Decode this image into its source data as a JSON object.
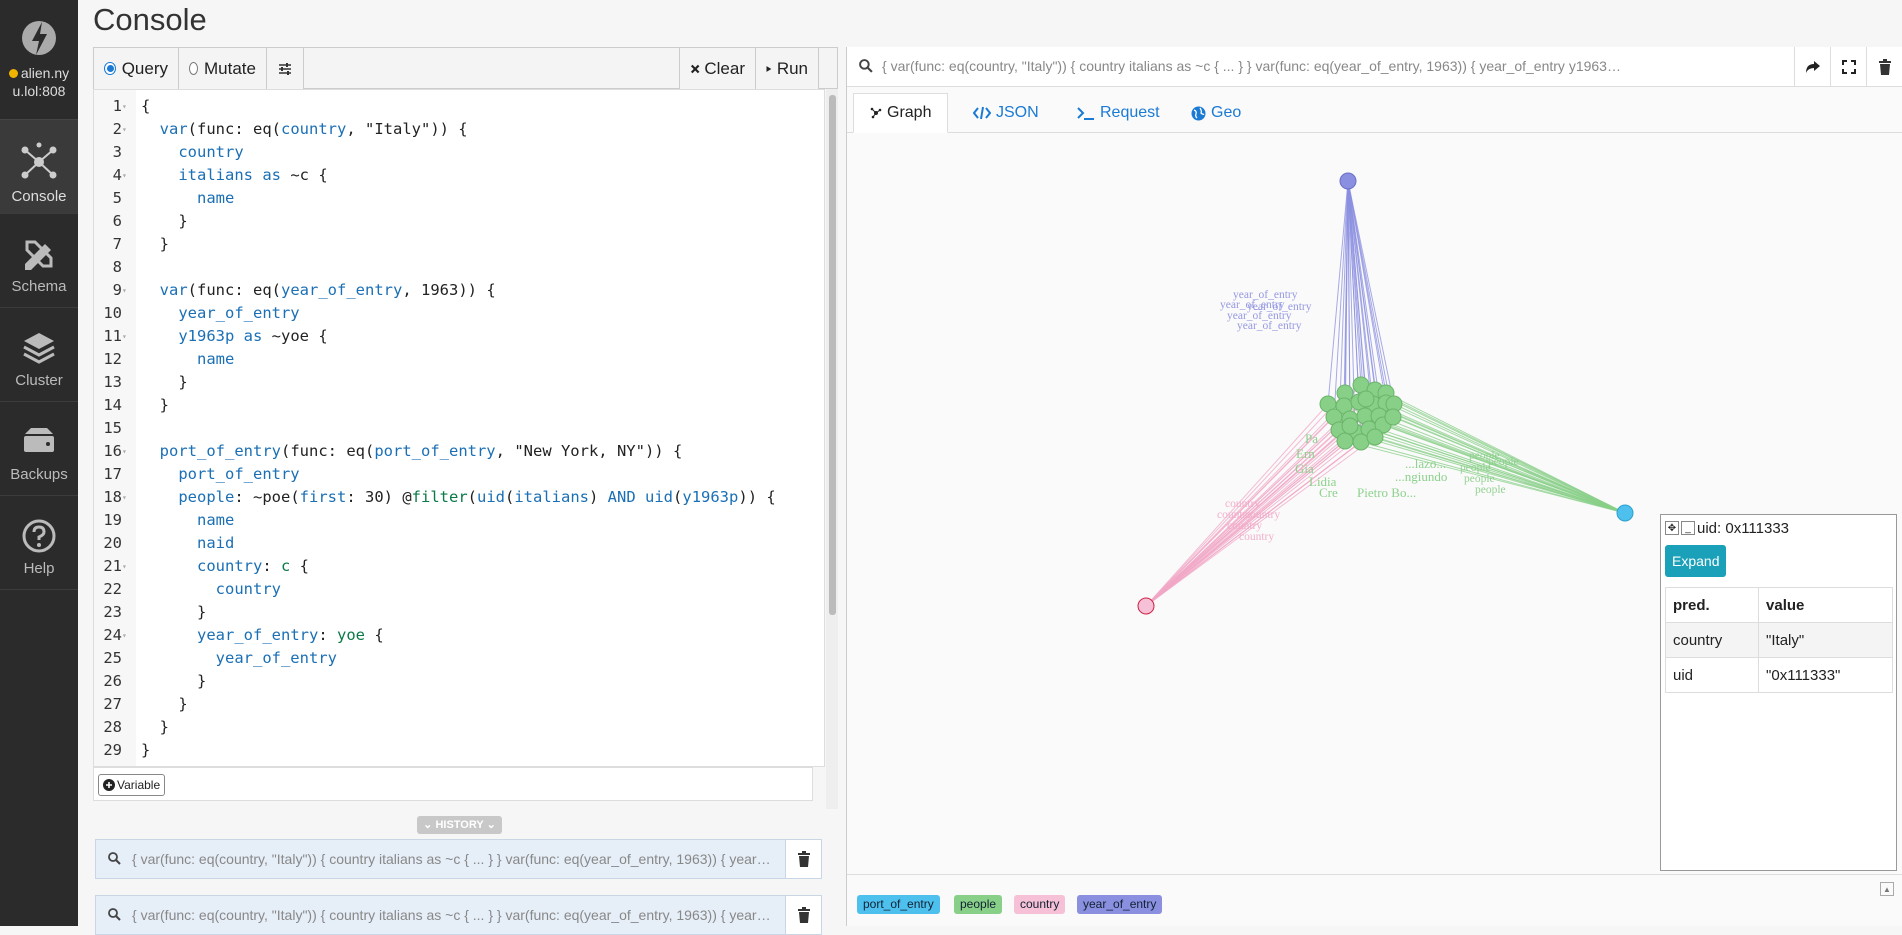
{
  "sidebar": {
    "server_name_line1": "alien.ny",
    "server_name_line2": "u.lol:808",
    "items": [
      {
        "label": "Console",
        "icon": "graph-nodes-icon",
        "active": true
      },
      {
        "label": "Schema",
        "icon": "pencil-ruler-icon"
      },
      {
        "label": "Cluster",
        "icon": "layers-icon"
      },
      {
        "label": "Backups",
        "icon": "storage-icon"
      },
      {
        "label": "Help",
        "icon": "question-icon"
      }
    ]
  },
  "page_title": "Console",
  "toolbar": {
    "query_label": "Query",
    "mutate_label": "Mutate",
    "clear_label": "Clear",
    "run_label": "Run"
  },
  "editor": {
    "line_numbers": [
      "1",
      "2",
      "3",
      "4",
      "5",
      "6",
      "7",
      "8",
      "9",
      "10",
      "11",
      "12",
      "13",
      "14",
      "15",
      "16",
      "17",
      "18",
      "19",
      "20",
      "21",
      "22",
      "23",
      "24",
      "25",
      "26",
      "27",
      "28",
      "29"
    ],
    "lines": [
      "{",
      "  var(func: eq(country, \"Italy\")) {",
      "    country",
      "    italians as ~c {",
      "      name",
      "    }",
      "  }",
      "",
      "  var(func: eq(year_of_entry, 1963)) {",
      "    year_of_entry",
      "    y1963p as ~yoe {",
      "      name",
      "    }",
      "  }",
      "",
      "  port_of_entry(func: eq(port_of_entry, \"New York, NY\")) {",
      "    port_of_entry",
      "    people: ~poe(first: 30) @filter(uid(italians) AND uid(y1963p)) {",
      "      name",
      "      naid",
      "      country: c {",
      "        country",
      "      }",
      "      year_of_entry: yoe {",
      "        year_of_entry",
      "      }",
      "    }",
      "  }",
      "}"
    ],
    "variable_label": "Variable"
  },
  "history": {
    "label": "HISTORY",
    "items": [
      "{ var(func: eq(country, \"Italy\")) { country italians as ~c { ... } } var(func: eq(year_of_entry, 1963)) { year_of_entry y1963p as ~yoe { ... } } port_of_entry(func: eq(port_of_entry, \"New York, NY\")) { ... } }",
      "{ var(func: eq(country, \"Italy\")) { country italians as ~c { ... } } var(func: eq(year_of_entry, 1963)) { year_of_entry y1963p as ~yoe { ... } } port_of_entry(func: eq(port_of_entry, \"New York, NY\")) { ... } }"
    ]
  },
  "result": {
    "query_text": "{ var(func: eq(country, \"Italy\")) { country italians as ~c { ... } } var(func: eq(year_of_entry, 1963)) { year_of_entry y1963p as ~yoe { ... } } port_of_entry(func: eq(port_of_entry, \"New York, NY\")) { ... } }",
    "tabs": [
      "Graph",
      "JSON",
      "Request",
      "Geo"
    ],
    "active_tab": "Graph",
    "graph_labels": {
      "year_label": "year_of_entry",
      "country_label": "country",
      "people_label": "people",
      "name_labels": [
        "Pa",
        "Ern",
        "Gia",
        "Lidia",
        "Cre",
        "Pietro Bo...",
        "...ngiundo",
        "...lazo..."
      ]
    },
    "legend": [
      {
        "label": "port_of_entry",
        "color": "#4dc0ee"
      },
      {
        "label": "people",
        "color": "#88cf88"
      },
      {
        "label": "country",
        "color": "#f6c0d6"
      },
      {
        "label": "year_of_entry",
        "color": "#8b8fe0"
      }
    ]
  },
  "inspector": {
    "title": "uid: 0x111333",
    "expand_label": "Expand",
    "col_pred": "pred.",
    "col_value": "value",
    "rows": [
      {
        "pred": "country",
        "value": "\"Italy\""
      },
      {
        "pred": "uid",
        "value": "\"0x111333\""
      }
    ]
  }
}
